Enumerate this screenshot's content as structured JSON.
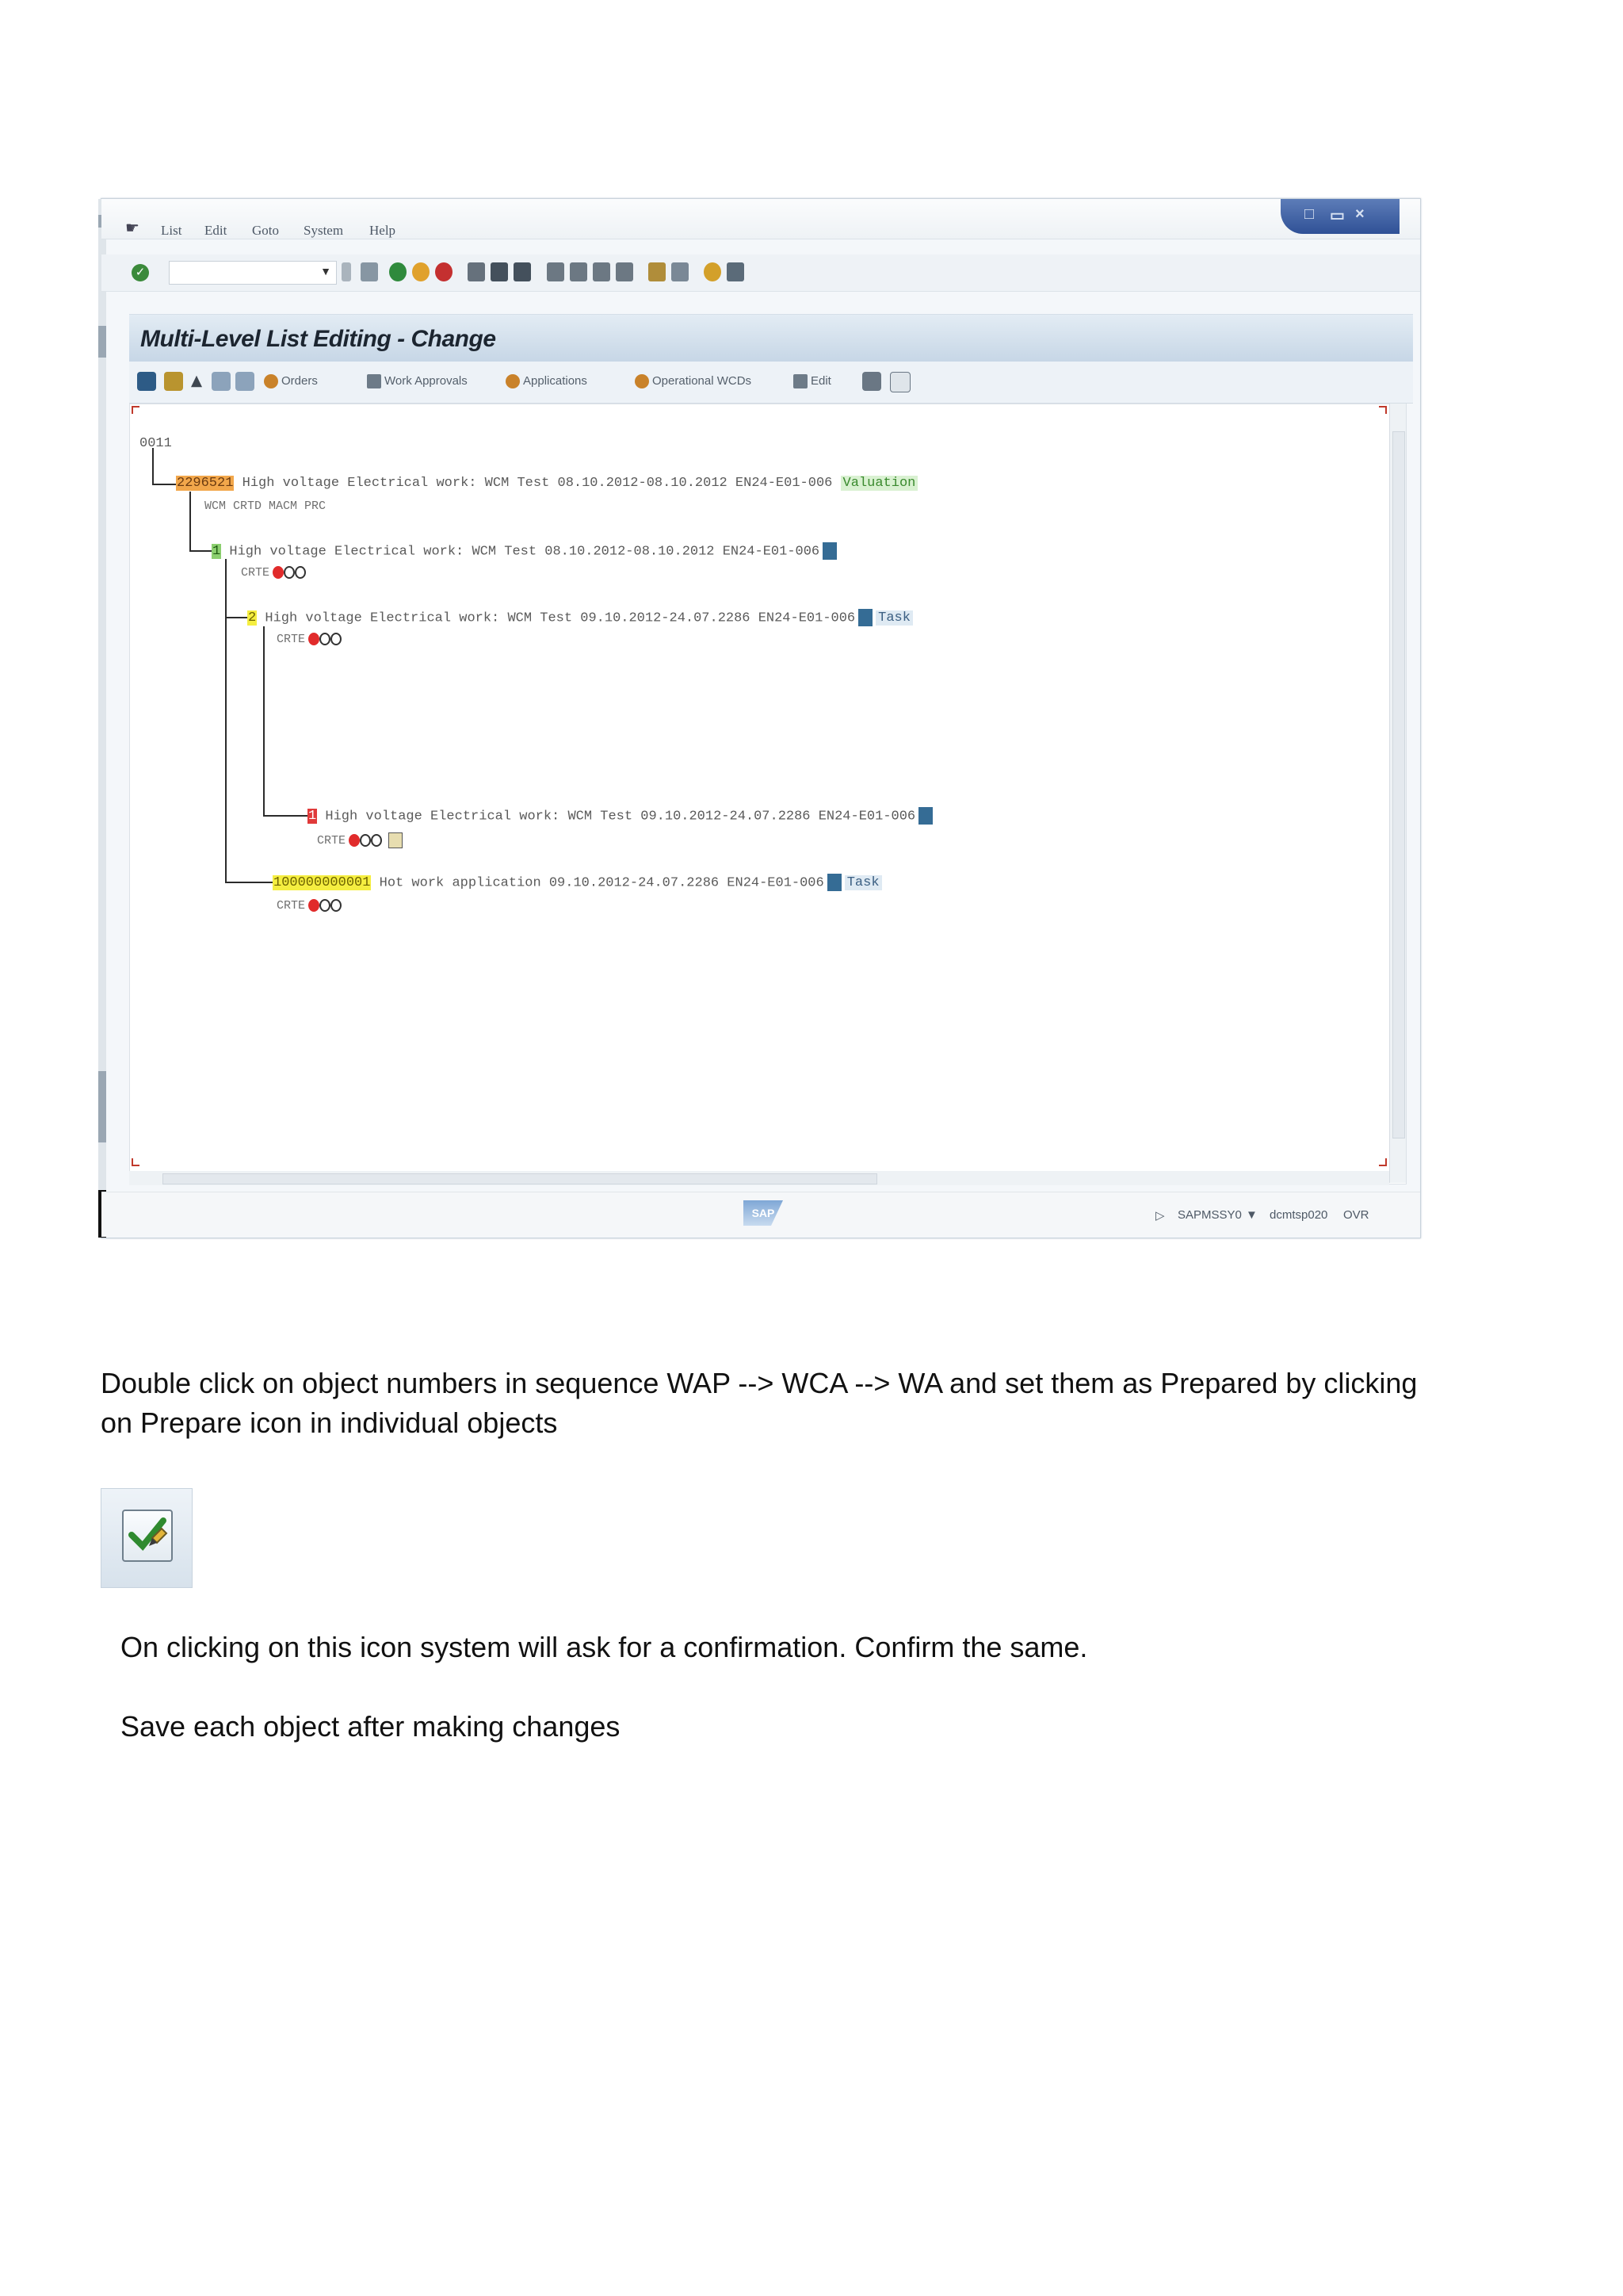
{
  "sap_window": {
    "menu": [
      "List",
      "Edit",
      "Goto",
      "System",
      "Help"
    ],
    "title": "Multi-Level List Editing - Change",
    "app_buttons": [
      {
        "label": "Orders",
        "color": "#c9822a"
      },
      {
        "label": "Work Approvals",
        "color": "#6d7b88"
      },
      {
        "label": "Applications",
        "color": "#c9822a"
      },
      {
        "label": "Operational WCDs",
        "color": "#c9822a"
      },
      {
        "label": "Edit",
        "color": "#6d7b88"
      }
    ],
    "tree": {
      "root": "0011",
      "node1": {
        "number": "2296521",
        "text": " High voltage Electrical work: WCM Test 08.10.2012-08.10.2012 EN24-E01-006 ",
        "status": "Valuation",
        "sub": "WCM  CRTD MACM PRC"
      },
      "node2": {
        "number": "1",
        "text": " High voltage Electrical work: WCM Test 08.10.2012-08.10.2012 EN24-E01-006",
        "sub": "CRTE"
      },
      "node3": {
        "number": "2",
        "text": " High voltage Electrical work: WCM Test 09.10.2012-24.07.2286 EN24-E01-006",
        "status": "Task",
        "sub": "CRTE"
      },
      "node4": {
        "number": "1",
        "text": " High voltage Electrical work: WCM Test 09.10.2012-24.07.2286 EN24-E01-006",
        "sub": "CRTE"
      },
      "node5": {
        "number": "100000000001",
        "text": " Hot work application 09.10.2012-24.07.2286 EN24-E01-006",
        "status": "Task",
        "sub": "CRTE"
      }
    },
    "statusbar": {
      "program": "SAPMSSY0",
      "server": "dcmtsp020",
      "mode": "OVR",
      "logo": "SAP"
    }
  },
  "instructions": {
    "paragraph1": "Double click on object numbers in sequence WAP --> WCA --> WA and set them as Prepared by clicking",
    "paragraph1b": "on Prepare icon in individual objects",
    "paragraph2": "On clicking on this icon system will ask for a confirmation. Confirm the same.",
    "paragraph3": "Save each object after making changes"
  }
}
